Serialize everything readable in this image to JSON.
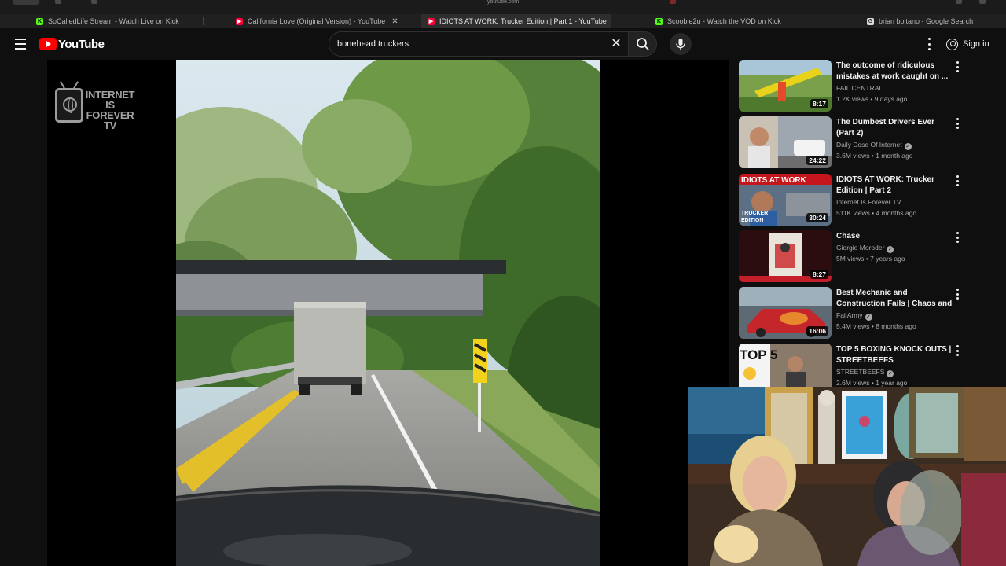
{
  "browser": {
    "url": "youtube.com",
    "tabs": [
      {
        "label": "SoCalledLife Stream - Watch Live on Kick",
        "favicon": "kick-icon"
      },
      {
        "label": "California Love (Original Version) - YouTube",
        "favicon": "youtube-icon"
      },
      {
        "label": "IDIOTS AT WORK: Trucker Edition | Part 1 - YouTube",
        "favicon": "youtube-icon",
        "active": true
      },
      {
        "label": "Scoobie2u - Watch the VOD on Kick",
        "favicon": "kick-icon"
      },
      {
        "label": "brian boitano - Google Search",
        "favicon": "google-icon"
      }
    ]
  },
  "header": {
    "logo_text": "YouTube",
    "search_value": "bonehead truckers",
    "signin_label": "Sign in"
  },
  "player": {
    "watermark_text": "INTERNET IS FOREVER TV"
  },
  "recommendations": [
    {
      "title": "The outcome of ridiculous mistakes at work caught on ...",
      "channel": "FAIL CENTRAL",
      "verified": false,
      "stats": "1.2K views • 9 days ago",
      "duration": "8:17"
    },
    {
      "title": "The Dumbest Drivers Ever (Part 2)",
      "channel": "Daily Dose Of Internet",
      "verified": true,
      "stats": "3.6M views • 1 month ago",
      "duration": "24:22"
    },
    {
      "title": "IDIOTS AT WORK: Trucker Edition | Part 2",
      "channel": "Internet Is Forever TV",
      "verified": false,
      "stats": "511K views • 4 months ago",
      "duration": "30:24",
      "thumb_text": [
        "IDIOTS AT WORK",
        "TRUCKER",
        "EDITION"
      ]
    },
    {
      "title": "Chase",
      "channel": "Giorgio Moroder",
      "verified": true,
      "stats": "5M views • 7 years ago",
      "duration": "8:27"
    },
    {
      "title": "Best Mechanic and Construction Fails | Chaos and ...",
      "channel": "FailArmy",
      "verified": true,
      "stats": "5.4M views • 8 months ago",
      "duration": "16:06"
    },
    {
      "title": "TOP 5 BOXING KNOCK OUTS | STREETBEEFS",
      "channel": "STREETBEEFS",
      "verified": true,
      "stats": "2.6M views • 1 year ago",
      "duration": "",
      "thumb_text": [
        "TOP 5"
      ]
    }
  ],
  "colors": {
    "youtube_red": "#ff0000",
    "kick_green": "#53fc18",
    "background": "#0f0f0f"
  }
}
